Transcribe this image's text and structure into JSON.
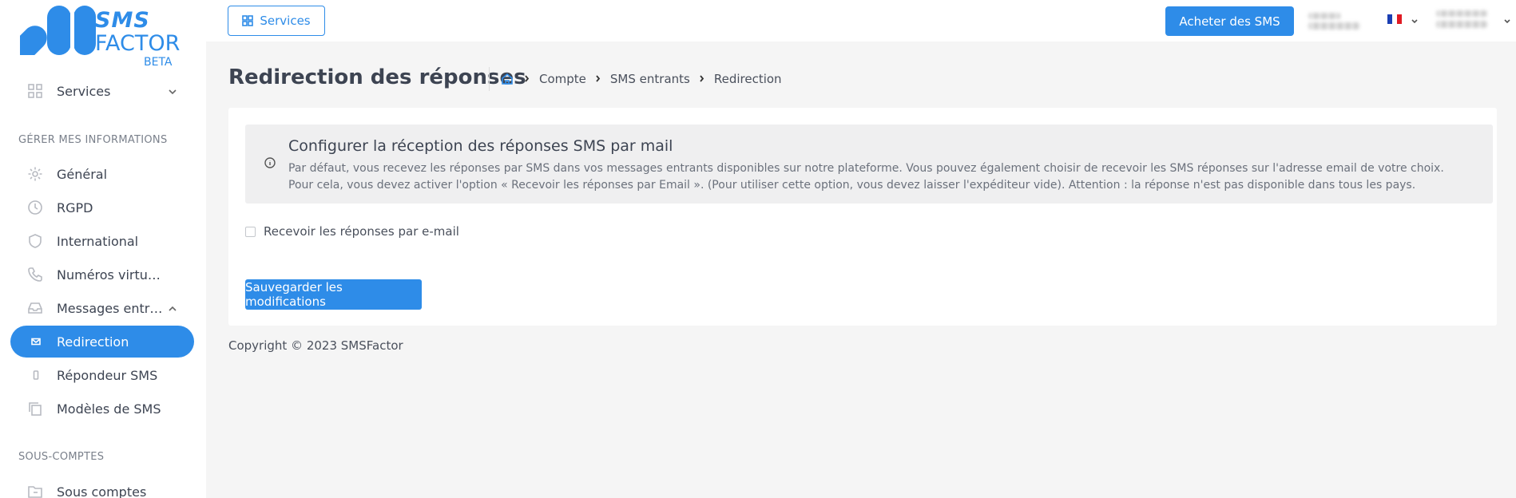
{
  "brand": {
    "line1": "SMS",
    "line2": "FACTOR",
    "tag": "BETA",
    "color": "#2e8ce8"
  },
  "topbar": {
    "services_label": "Services",
    "buy_label": "Acheter des SMS",
    "language_flag": "fr-flag-icon"
  },
  "sidebar": {
    "services_label": "Services",
    "section_manage": "GÉRER MES INFORMATIONS",
    "items": [
      {
        "label": "Général",
        "icon": "gear-icon"
      },
      {
        "label": "RGPD",
        "icon": "clock-icon"
      },
      {
        "label": "International",
        "icon": "shield-icon"
      },
      {
        "label": "Numéros virtuels",
        "icon": "phone-icon"
      },
      {
        "label": "Messages entrants",
        "icon": "inbox-icon"
      },
      {
        "label": "Redirection",
        "icon": "mail-icon"
      },
      {
        "label": "Répondeur SMS",
        "icon": "mobile-icon"
      },
      {
        "label": "Modèles de SMS",
        "icon": "copy-icon"
      }
    ],
    "section_sub": "SOUS-COMPTES",
    "sub_accounts_label": "Sous comptes"
  },
  "page": {
    "title": "Redirection des réponses",
    "breadcrumb": [
      "Compte",
      "SMS entrants",
      "Redirection"
    ]
  },
  "alert": {
    "title": "Configurer la réception des réponses SMS par mail",
    "line1": "Par défaut, vous recevez les réponses par SMS dans vos messages entrants disponibles sur notre plateforme. Vous pouvez également choisir de recevoir les SMS réponses sur l'adresse email de votre choix.",
    "line2": "Pour cela, vous devez activer l'option « Recevoir les réponses par Email ». (Pour utiliser cette option, vous devez laisser l'expéditeur vide). Attention : la réponse n'est pas disponible dans tous les pays."
  },
  "form": {
    "checkbox_label": "Recevoir les réponses par e-mail",
    "checkbox_checked": false,
    "save_label": "Sauvegarder les modifications"
  },
  "footer": {
    "copyright": "Copyright © 2023 SMSFactor"
  }
}
